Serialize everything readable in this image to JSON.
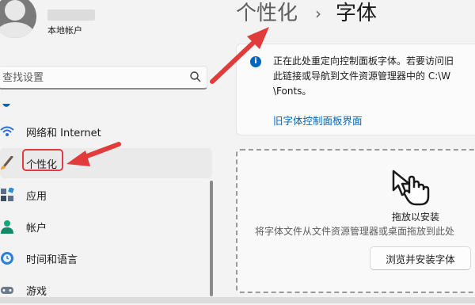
{
  "account": {
    "label": "本地帐户"
  },
  "search": {
    "placeholder": "查找设置"
  },
  "nav": {
    "items": [
      {
        "label": "网络和 Internet",
        "icon": "wifi-icon"
      },
      {
        "label": "个性化",
        "icon": "brush-icon"
      },
      {
        "label": "应用",
        "icon": "apps-icon"
      },
      {
        "label": "帐户",
        "icon": "account-icon"
      },
      {
        "label": "时间和语言",
        "icon": "globe-clock-icon"
      },
      {
        "label": "游戏",
        "icon": "game-icon"
      }
    ],
    "selected": "个性化"
  },
  "header": {
    "parent": "个性化",
    "separator": "›",
    "current": "字体"
  },
  "info": {
    "text": "正在此处重定向控制面板字体。若要访问旧\n此链接或导航到文件资源管理器中的 C:\\W\n\\Fonts。",
    "link": "旧字体控制面板界面"
  },
  "dropzone": {
    "title": "拖放以安装",
    "subtitle": "将字体文件从文件资源管理器或桌面拖放到此处",
    "button": "浏览并安装字体"
  },
  "colors": {
    "accent": "#0067c0",
    "annotation": "#e13b3b"
  }
}
